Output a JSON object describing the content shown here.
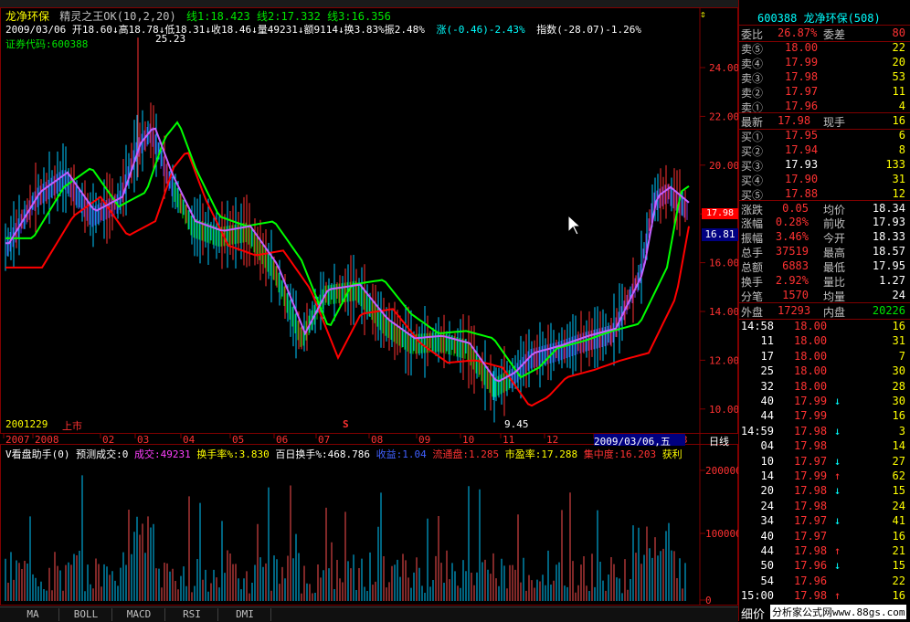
{
  "header": {
    "stock_name": "龙净环保",
    "indicator": "精灵之王OK(10,2,20)",
    "line1": "线1:18.423",
    "line2": "线2:17.332",
    "line3": "线3:16.356",
    "ohlc_line": "2009/03/06 开18.60↓高18.78↓低18.31↓收18.46↓量49231↓额9114↓换3.83%振2.48%",
    "change": "涨(-0.46)-2.43%",
    "index": "指数(-28.07)-1.26%",
    "code": "证券代码:600388",
    "peak_label": "25.23",
    "low_label": "9.45",
    "start_date": "2001229",
    "listed": "上市",
    "s_marker": "S",
    "day_line": "日线",
    "cursor_date": "2009/03/06,五"
  },
  "price_axis": [
    "24.00",
    "22.00",
    "20.00",
    "18.00",
    "16.00",
    "14.00",
    "12.00",
    "10.00"
  ],
  "price_tag_current": "17.98",
  "price_tag_cursor": "16.81",
  "time_axis": [
    "2007",
    "2008",
    "02",
    "03",
    "04",
    "05",
    "06",
    "07",
    "08",
    "09",
    "10",
    "11",
    "12",
    "2009",
    "3"
  ],
  "volume_header": {
    "name": "V看盘助手(0)",
    "forecast": "预测成交:0",
    "vol": "成交:49231",
    "turnover": "换手率%:3.830",
    "hundred": "百日换手%:468.786",
    "income": "收益:1.04",
    "float": "流通盘:1.285",
    "pe": "市盈率:17.288",
    "concentration": "集中度:16.203",
    "profit": "获利"
  },
  "volume_axis": [
    "200000",
    "100000",
    "0"
  ],
  "tabs": [
    "MA",
    "BOLL",
    "MACD",
    "RSI",
    "DMI"
  ],
  "quote": {
    "code_title": "600388 龙净环保(508)",
    "ratio_label": "委比",
    "ratio_value": "26.87%",
    "diff_label": "委差",
    "diff_value": "80",
    "sells": [
      {
        "label": "卖⑤",
        "price": "18.00",
        "vol": "22"
      },
      {
        "label": "卖④",
        "price": "17.99",
        "vol": "20"
      },
      {
        "label": "卖③",
        "price": "17.98",
        "vol": "53"
      },
      {
        "label": "卖②",
        "price": "17.97",
        "vol": "11"
      },
      {
        "label": "卖①",
        "price": "17.96",
        "vol": "4"
      }
    ],
    "last_label": "最新",
    "last_price": "17.98",
    "now_label": "现手",
    "now_vol": "16",
    "buys": [
      {
        "label": "买①",
        "price": "17.95",
        "vol": "6"
      },
      {
        "label": "买②",
        "price": "17.94",
        "vol": "8"
      },
      {
        "label": "买③",
        "price": "17.93",
        "vol": "133"
      },
      {
        "label": "买④",
        "price": "17.90",
        "vol": "31"
      },
      {
        "label": "买⑤",
        "price": "17.88",
        "vol": "12"
      }
    ],
    "stats": [
      {
        "l1": "涨跌",
        "v1": "0.05",
        "l2": "均价",
        "v2": "18.34"
      },
      {
        "l1": "涨幅",
        "v1": "0.28%",
        "l2": "前收",
        "v2": "17.93"
      },
      {
        "l1": "振幅",
        "v1": "3.46%",
        "l2": "今开",
        "v2": "18.33"
      },
      {
        "l1": "总手",
        "v1": "37519",
        "l2": "最高",
        "v2": "18.57"
      },
      {
        "l1": "总额",
        "v1": "6883",
        "l2": "最低",
        "v2": "17.95"
      },
      {
        "l1": "换手",
        "v1": "2.92%",
        "l2": "量比",
        "v2": "1.27"
      },
      {
        "l1": "分笔",
        "v1": "1570",
        "l2": "均量",
        "v2": "24"
      }
    ],
    "outer_label": "外盘",
    "outer_value": "17293",
    "inner_label": "内盘",
    "inner_value": "20226"
  },
  "ticks": [
    {
      "time": "14:58",
      "price": "18.00",
      "arrow": "",
      "vol": "16"
    },
    {
      "time": "11",
      "price": "18.00",
      "arrow": "",
      "vol": "31"
    },
    {
      "time": "17",
      "price": "18.00",
      "arrow": "",
      "vol": "7"
    },
    {
      "time": "25",
      "price": "18.00",
      "arrow": "",
      "vol": "30"
    },
    {
      "time": "32",
      "price": "18.00",
      "arrow": "",
      "vol": "28"
    },
    {
      "time": "40",
      "price": "17.99",
      "arrow": "↓",
      "vol": "30"
    },
    {
      "time": "44",
      "price": "17.99",
      "arrow": "",
      "vol": "16"
    },
    {
      "time": "14:59",
      "price": "17.98",
      "arrow": "↓",
      "vol": "3"
    },
    {
      "time": "04",
      "price": "17.98",
      "arrow": "",
      "vol": "14"
    },
    {
      "time": "10",
      "price": "17.97",
      "arrow": "↓",
      "vol": "27"
    },
    {
      "time": "14",
      "price": "17.99",
      "arrow": "↑",
      "vol": "62"
    },
    {
      "time": "20",
      "price": "17.98",
      "arrow": "↓",
      "vol": "15"
    },
    {
      "time": "24",
      "price": "17.98",
      "arrow": "",
      "vol": "24"
    },
    {
      "time": "34",
      "price": "17.97",
      "arrow": "↓",
      "vol": "41"
    },
    {
      "time": "40",
      "price": "17.97",
      "arrow": "",
      "vol": "16"
    },
    {
      "time": "44",
      "price": "17.98",
      "arrow": "↑",
      "vol": "21"
    },
    {
      "time": "50",
      "price": "17.96",
      "arrow": "↓",
      "vol": "15"
    },
    {
      "time": "54",
      "price": "17.96",
      "arrow": "",
      "vol": "22"
    },
    {
      "time": "15:00",
      "price": "17.98",
      "arrow": "↑",
      "vol": "16"
    }
  ],
  "footer_left": "细价",
  "watermark": "分析家公式网www.88gs.com",
  "colors": {
    "up": "#ff3232",
    "down": "#00e600",
    "ma_red": "#ff0000",
    "ma_green": "#00ff00",
    "ma_purple": "#6040ff",
    "frame": "#800000"
  }
}
